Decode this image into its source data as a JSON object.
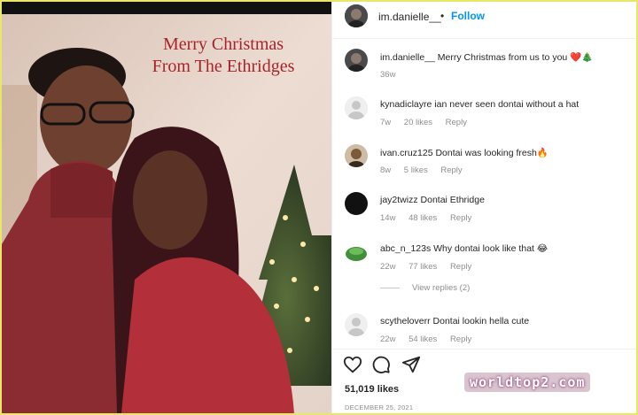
{
  "photo": {
    "caption_line1": "Merry Christmas",
    "caption_line2": "From The Ethridges"
  },
  "header": {
    "username": "im.danielle__",
    "separator": "•",
    "follow_label": "Follow"
  },
  "caption": {
    "username": "im.danielle__",
    "text": "Merry Christmas from us to you ❤️🎄",
    "age": "36w"
  },
  "comments": [
    {
      "username": "kynadiclayre",
      "text": "ian never seen dontai without a hat",
      "age": "7w",
      "likes": "20 likes",
      "reply": "Reply",
      "avatar_color": "#dbdbdb"
    },
    {
      "username": "ivan.cruz125",
      "text": "Dontai was looking fresh🔥",
      "age": "8w",
      "likes": "5 likes",
      "reply": "Reply",
      "avatar_color": "#8a6a4a"
    },
    {
      "username": "jay2twizz",
      "text": "Dontai Ethridge",
      "age": "14w",
      "likes": "48 likes",
      "reply": "Reply",
      "avatar_color": "#111111"
    },
    {
      "username": "abc_n_123s",
      "text": "Why dontai look like that 😂",
      "age": "22w",
      "likes": "77 likes",
      "reply": "Reply",
      "avatar_color": "#3f8f3a"
    },
    {
      "username": "scytheloverr",
      "text": "Dontai lookin hella cute",
      "age": "22w",
      "likes": "54 likes",
      "reply": "Reply",
      "avatar_color": "#dbdbdb"
    }
  ],
  "view_replies": "View replies (2)",
  "actions": {
    "like_icon": "heart-icon",
    "comment_icon": "comment-icon",
    "share_icon": "send-icon"
  },
  "likes_count": "51,019 likes",
  "post_date": "DECEMBER 25, 2021",
  "watermark": "worldtop2.com",
  "colors": {
    "accent": "#0095f6",
    "caption_red": "#a8232a",
    "border_yellow": "#e9e76a"
  }
}
